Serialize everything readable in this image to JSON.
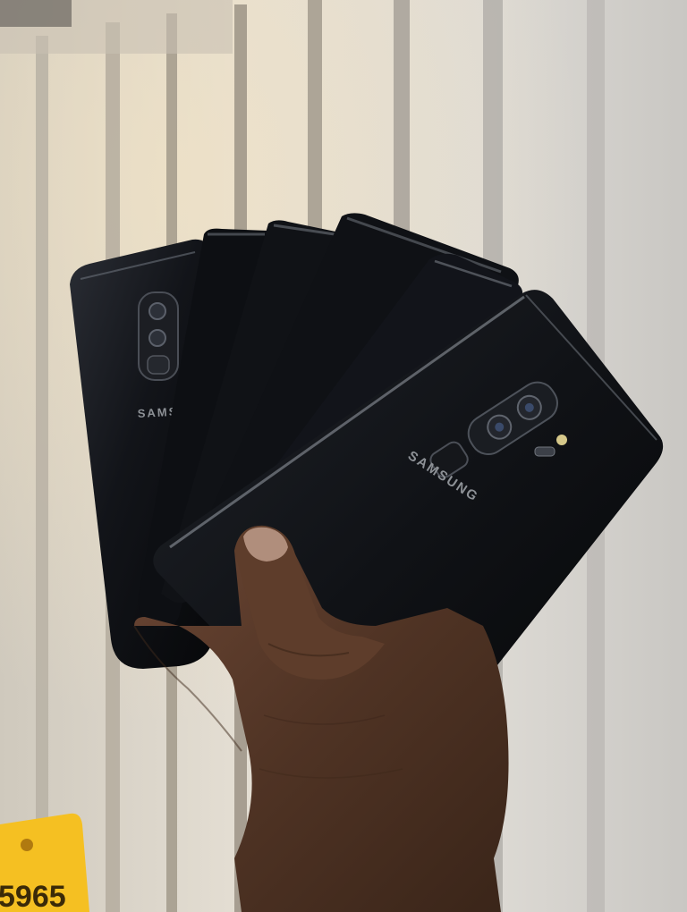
{
  "scene": {
    "brand_back": "SAMSUNG",
    "brand_front": "SAMSUNG",
    "price_tag": {
      "number": "5965",
      "color": "#f5c022"
    }
  },
  "colors": {
    "phone_body": "#15171c",
    "skin": "#5a3b2a",
    "wall": "#dcd9d2"
  }
}
